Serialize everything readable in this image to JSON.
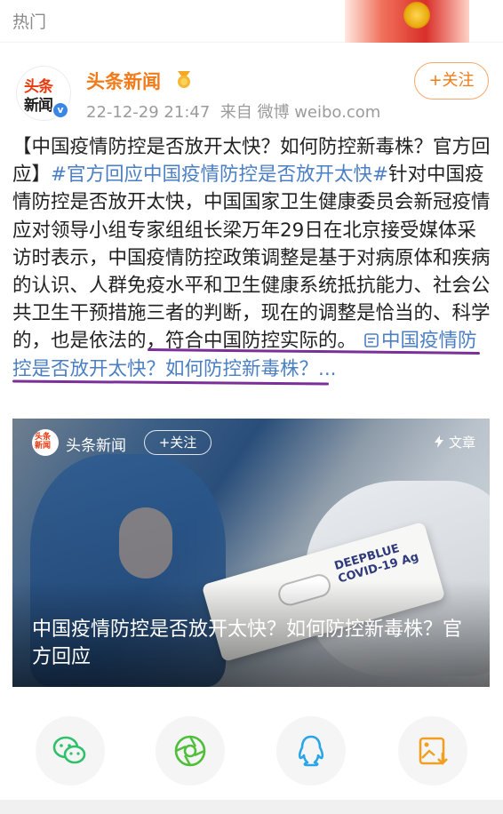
{
  "top": {
    "section_label": "热门"
  },
  "account": {
    "logo_line1": "头条",
    "logo_line2": "新闻",
    "verified_mark": "v",
    "name": "头条新闻",
    "time": "22-12-29 21:47",
    "source": "来自 微博 weibo.com",
    "follow_label": "+关注"
  },
  "post": {
    "text_1": "【中国疫情防控是否放开太快？如何防控新毒株？官方回应】",
    "hashtag": "#官方回应中国疫情防控是否放开太快#",
    "text_2": "针对中国疫情防控是否放开太快，中国国家卫生健康委员会新冠疫情应对领导小组专家组组长梁万年29日在北京接受媒体采访时表示，中国疫情防控政策调整是基于对病原体和疾病的认识、人群免疫水平和卫生健康系统抵抗能力、社会公共卫生干预措施三者的判断，",
    "text_underlined": "现在的调整是恰当的、科学的，也是依法的，符合中国防控实际的。",
    "link_text": "中国疫情防控是否放开太快？如何防控新毒株？...",
    "underline_color": "#7a2f99",
    "link_color": "#4b7fc4"
  },
  "card": {
    "logo_text": "头条新闻",
    "author": "头条新闻",
    "follow_label": "+关注",
    "type_label": "文章",
    "title": "中国疫情防控是否放开太快？如何防控新毒株？官方回应",
    "kit_text": "DEEPBLUE COVID-19 Ag"
  },
  "share": [
    {
      "icon": "wechat-icon",
      "color": "#2ec06b"
    },
    {
      "icon": "moments-icon",
      "color": "#4fbf3a"
    },
    {
      "icon": "qq-icon",
      "color": "#2aa5e8"
    },
    {
      "icon": "save-image-icon",
      "color": "#f0a020"
    }
  ],
  "colors": {
    "accent": "#f27b19",
    "link": "#4b7fc4"
  }
}
